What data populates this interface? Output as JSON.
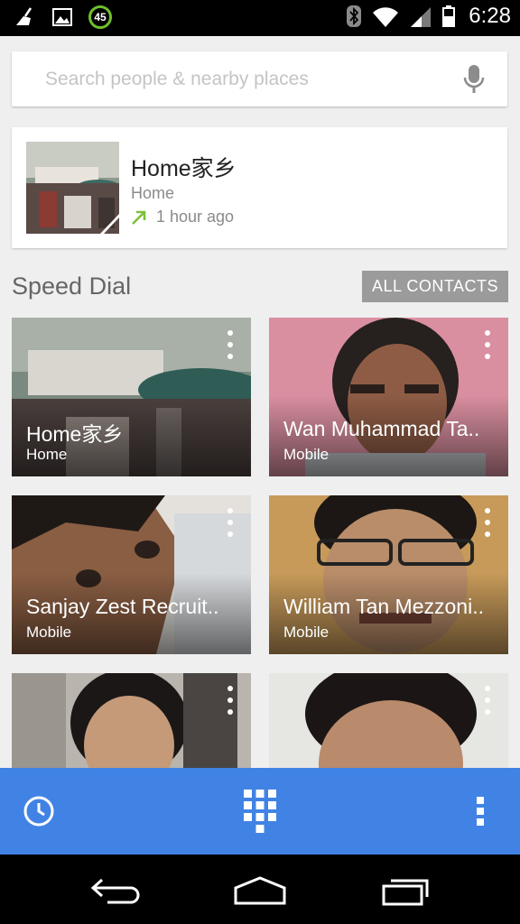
{
  "status_bar": {
    "time": "6:28",
    "notification_badge": "45",
    "icons": [
      "cleaner-icon",
      "image-icon",
      "badge-45-icon",
      "bluetooth-icon",
      "wifi-icon",
      "signal-icon",
      "battery-icon"
    ]
  },
  "search": {
    "placeholder": "Search people & nearby places",
    "value": "",
    "mic_icon": "mic-icon"
  },
  "recent_call": {
    "name": "Home家乡",
    "type": "Home",
    "time_ago": "1 hour ago",
    "call_direction_icon": "outgoing-call-icon",
    "direction_color": "#7cc13a"
  },
  "speed_dial": {
    "title": "Speed Dial",
    "all_contacts_label": "ALL CONTACTS",
    "tiles": [
      {
        "name": "Home家乡",
        "type": "Home"
      },
      {
        "name": "Wan Muhammad Ta..",
        "type": "Mobile"
      },
      {
        "name": "Sanjay Zest Recruit..",
        "type": "Mobile"
      },
      {
        "name": "William Tan Mezzoni..",
        "type": "Mobile"
      },
      {
        "name": "",
        "type": ""
      },
      {
        "name": "",
        "type": ""
      }
    ]
  },
  "action_bar": {
    "color": "#4183e4",
    "buttons": [
      "call-history-icon",
      "dialpad-icon",
      "overflow-menu-icon"
    ]
  },
  "nav_bar": {
    "buttons": [
      "back-icon",
      "home-icon",
      "recent-apps-icon"
    ]
  }
}
